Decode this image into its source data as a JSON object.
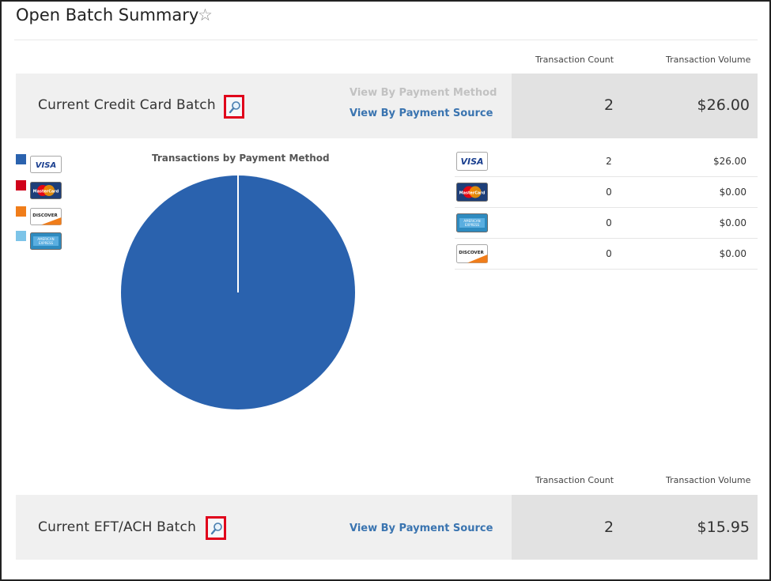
{
  "page": {
    "title": "Open Batch Summary"
  },
  "headers": {
    "count": "Transaction Count",
    "volume": "Transaction Volume"
  },
  "credit_batch": {
    "title": "Current Credit Card Batch",
    "view_by_method": "View By Payment Method",
    "view_by_source": "View By Payment Source",
    "count": "2",
    "volume": "$26.00"
  },
  "chart": {
    "title": "Transactions by Payment Method",
    "legend": [
      {
        "card": "VISA",
        "color": "#2a62ae"
      },
      {
        "card": "MasterCard",
        "color": "#d0021b"
      },
      {
        "card": "DISCOVER",
        "color": "#f07d1a"
      },
      {
        "card": "AMERICAN EXPRESS",
        "color": "#7cc4e8"
      }
    ]
  },
  "chart_data": {
    "type": "pie",
    "title": "Transactions by Payment Method",
    "categories": [
      "VISA",
      "MasterCard",
      "DISCOVER",
      "AMERICAN EXPRESS"
    ],
    "values": [
      2,
      0,
      0,
      0
    ],
    "colors": [
      "#2a62ae",
      "#d0021b",
      "#f07d1a",
      "#7cc4e8"
    ]
  },
  "transactions": [
    {
      "card": "VISA",
      "count": "2",
      "volume": "$26.00"
    },
    {
      "card": "MasterCard",
      "count": "0",
      "volume": "$0.00"
    },
    {
      "card": "AMERICAN EXPRESS",
      "count": "0",
      "volume": "$0.00"
    },
    {
      "card": "DISCOVER",
      "count": "0",
      "volume": "$0.00"
    }
  ],
  "eft_batch": {
    "title": "Current EFT/ACH Batch",
    "view_by_source": "View By Payment Source",
    "count": "2",
    "volume": "$15.95"
  }
}
